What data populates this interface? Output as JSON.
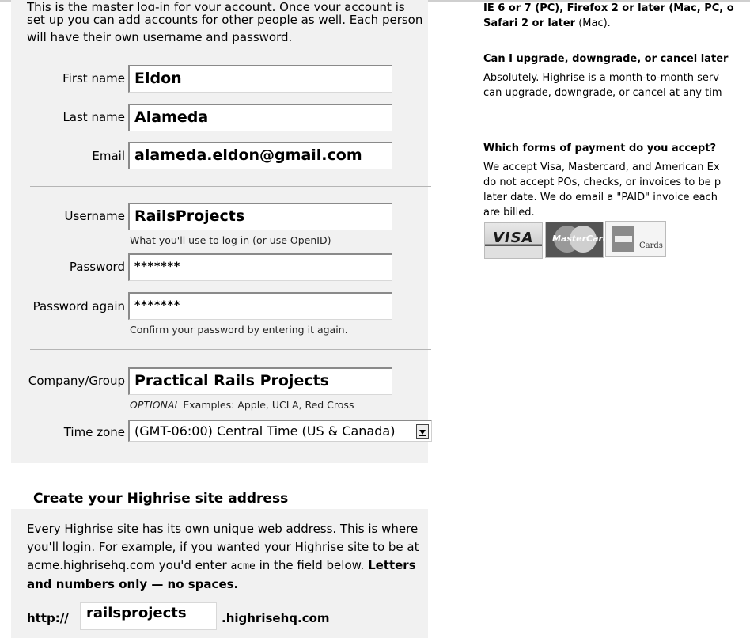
{
  "account": {
    "intro_line1": "This is the master log-in for your account. Once your account is",
    "intro_rest": "set up you can add accounts for other people as well. Each person will have their own username and password.",
    "first_name": {
      "label": "First name",
      "value": "Eldon"
    },
    "last_name": {
      "label": "Last name",
      "value": "Alameda"
    },
    "email": {
      "label": "Email",
      "value": "alameda.eldon@gmail.com"
    },
    "username": {
      "label": "Username",
      "value": "RailsProjects",
      "hint_prefix": "What you'll use to log in (or ",
      "hint_link": "use OpenID",
      "hint_suffix": ")"
    },
    "password": {
      "label": "Password",
      "value": "*******"
    },
    "password_again": {
      "label": "Password again",
      "value": "*******",
      "hint": "Confirm your password by entering it again."
    },
    "company": {
      "label": "Company/Group",
      "value": "Practical Rails Projects",
      "hint_optional": "OPTIONAL",
      "hint_examples": " Examples: Apple, UCLA, Red Cross"
    },
    "time_zone": {
      "label": "Time zone",
      "value": "(GMT-06:00) Central Time (US & Canada)"
    }
  },
  "site": {
    "legend": "Create your Highrise site address",
    "text_1": "Every Highrise site has its own unique web address. This is where you'll login. For example, if you wanted your Highrise site to be at acme.highrisehq.com you'd enter ",
    "text_code": "acme",
    "text_2": " in the field below. ",
    "text_bold": "Letters and numbers only — no spaces.",
    "prefix": "http://",
    "subdomain": "railsprojects",
    "suffix": ".highrisehq.com"
  },
  "faq": {
    "browsers_cut": "IE 6 or 7 (PC), Firefox 2 or later (Mac, PC, o",
    "browsers_bold": "Safari 2 or later",
    "browsers_tail": " (Mac).",
    "q1": "Can I upgrade, downgrade, or cancel later",
    "a1_l1": "Absolutely. Highrise is a month-to-month serv",
    "a1_l2": "can upgrade, downgrade, or cancel at any tim",
    "q2": "Which forms of payment do you accept?",
    "a2_l1": "We accept Visa, Mastercard, and American Ex",
    "a2_l2": "do not accept POs, checks, or invoices to be p",
    "a2_l3": "later date. We do email a \"PAID\" invoice each",
    "a2_l4": "are billed."
  },
  "cards": {
    "visa": "VISA",
    "mastercard": "MasterCard",
    "amex": "Cards"
  }
}
